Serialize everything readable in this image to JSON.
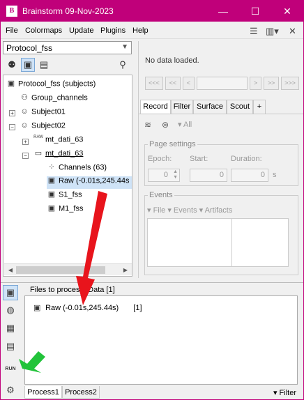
{
  "window": {
    "title": "Brainstorm 09-Nov-2023",
    "app_icon_text": "B",
    "minimize": "—",
    "maximize": "☐",
    "close": "✕"
  },
  "menu": {
    "items": [
      "File",
      "Colormaps",
      "Update",
      "Plugins",
      "Help"
    ]
  },
  "protocol": {
    "selected": "Protocol_fss"
  },
  "tree": {
    "root": "Protocol_fss (subjects)",
    "group": "Group_channels",
    "subject1": "Subject01",
    "subject2": "Subject02",
    "raw_folder": "mt_dati_63",
    "raw_tag": "RAW",
    "folder": "mt_dati_63",
    "channels": "Channels (63)",
    "raw_file": "Raw (-0.01s,245.44s",
    "s1": "S1_fss",
    "m1": "M1_fss"
  },
  "viewer": {
    "nodata": "No data loaded.",
    "nav_buttons": [
      "<<<",
      "<<",
      "<",
      ">",
      ">>",
      ">>>"
    ]
  },
  "tabs": [
    "Record",
    "Filter",
    "Surface",
    "Scout",
    "+"
  ],
  "record": {
    "all_label": "▾ All",
    "page_settings": "Page settings",
    "epoch_label": "Epoch:",
    "start_label": "Start:",
    "duration_label": "Duration:",
    "epoch_value": "0",
    "start_value": "0",
    "duration_value": "0",
    "unit": "s",
    "events_title": "Events",
    "events_menu": "▾ File  ▾ Events  ▾ Artifacts"
  },
  "process": {
    "files_title": "Files to process: Data [1]",
    "file_label": "Raw (-0.01s,245.44s)",
    "file_count": "[1]",
    "run_label": "RUN",
    "tab1": "Process1",
    "tab2": "Process2",
    "filter": "▾ Filter"
  },
  "colors": {
    "title_bar": "#c0007a",
    "arrow_red": "#e8141c",
    "arrow_green": "#22c33a",
    "selection": "#cfe3f7"
  }
}
